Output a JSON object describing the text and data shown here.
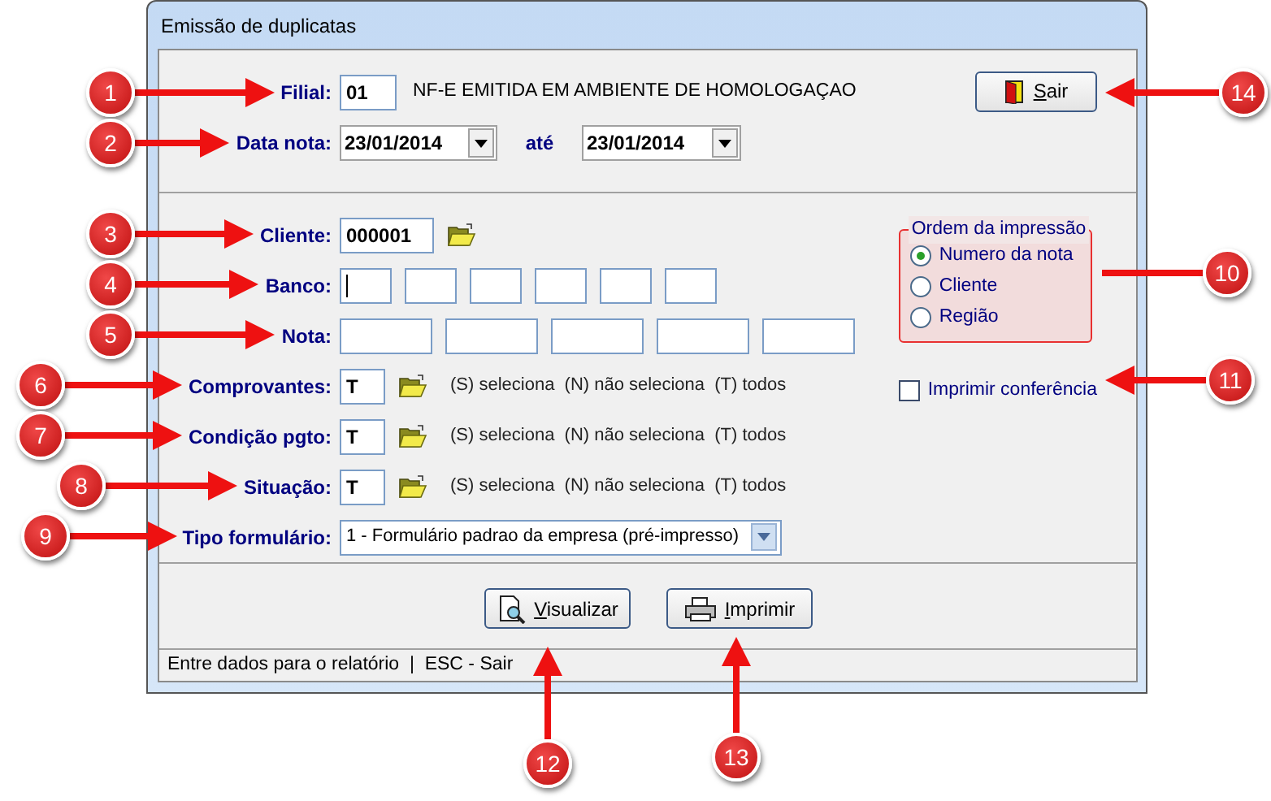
{
  "window": {
    "title": "Emissão de duplicatas"
  },
  "filial": {
    "label": "Filial:",
    "value": "01",
    "description": "NF-E EMITIDA EM AMBIENTE DE HOMOLOGAÇAO"
  },
  "exit_button": "Sair",
  "data_nota": {
    "label": "Data nota:",
    "from": "23/01/2014",
    "separator": "até",
    "to": "23/01/2014"
  },
  "fields": [
    {
      "kind": "lookup",
      "label": "Cliente:",
      "value": "000001"
    },
    {
      "kind": "bank",
      "label": "Banco:",
      "focused": true
    },
    {
      "kind": "note",
      "label": "Nota:"
    },
    {
      "kind": "filter",
      "label": "Comprovantes:",
      "value": "T",
      "hint": "(S) seleciona  (N) não seleciona  (T) todos"
    },
    {
      "kind": "filter",
      "label": "Condição pgto:",
      "value": "T",
      "hint": "(S) seleciona  (N) não seleciona  (T) todos"
    },
    {
      "kind": "filter",
      "label": "Situação:",
      "value": "T",
      "hint": "(S) seleciona  (N) não seleciona  (T) todos"
    },
    {
      "kind": "select",
      "label": "Tipo formulário:",
      "value": "1 - Formulário padrao da empresa (pré-impresso)"
    }
  ],
  "order_group": {
    "title": "Ordem da impressão",
    "options": [
      {
        "label": "Numero da nota",
        "selected": true
      },
      {
        "label": "Cliente",
        "selected": false
      },
      {
        "label": "Região",
        "selected": false
      }
    ]
  },
  "checkbox": {
    "label": "Imprimir conferência",
    "checked": false
  },
  "buttons": [
    {
      "label": "Visualizar",
      "kind": "preview"
    },
    {
      "label": "Imprimir",
      "kind": "print"
    }
  ],
  "status_bar": "Entre dados para o relatório  |  ESC - Sair",
  "annotations": [
    {
      "number": "1",
      "kind": "arrow"
    },
    {
      "number": "2",
      "kind": "arrow"
    },
    {
      "number": "3",
      "kind": "arrow"
    },
    {
      "number": "4",
      "kind": "arrow"
    },
    {
      "number": "5",
      "kind": "arrow"
    },
    {
      "number": "6",
      "kind": "arrow"
    },
    {
      "number": "7",
      "kind": "arrow"
    },
    {
      "number": "8",
      "kind": "arrow"
    },
    {
      "number": "9",
      "kind": "arrow"
    },
    {
      "number": "10",
      "kind": "line"
    },
    {
      "number": "11",
      "kind": "arrow"
    },
    {
      "number": "12",
      "kind": "arrow"
    },
    {
      "number": "13",
      "kind": "arrow"
    },
    {
      "number": "14",
      "kind": "arrow"
    }
  ]
}
